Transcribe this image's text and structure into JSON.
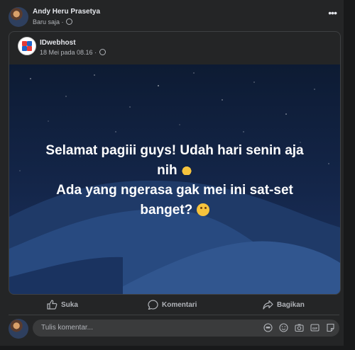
{
  "post": {
    "author_name": "Andy Heru Prasetya",
    "timestamp": "Baru saja",
    "privacy_icon": "globe-icon",
    "more_label": "•••"
  },
  "shared_post": {
    "page_name": "IDwebhost",
    "timestamp": "18 Mei pada 08.16",
    "privacy_icon": "globe-icon",
    "text_line1": "Selamat pagiii guys! Udah hari senin aja",
    "text_line2": "nih",
    "text_line3": "Ada yang ngerasa gak mei ini sat-set",
    "text_line4": "banget?"
  },
  "actions": {
    "like_label": "Suka",
    "comment_label": "Komentari",
    "share_label": "Bagikan"
  },
  "comment": {
    "placeholder": "Tulis komentar...",
    "icons": [
      "avatar-sticker-icon",
      "emoji-icon",
      "camera-icon",
      "gif-icon",
      "sticker-icon"
    ]
  },
  "colors": {
    "background": "#242526",
    "text_primary": "#e4e6eb",
    "text_secondary": "#b0b3b8",
    "comment_box": "#3a3b3c"
  }
}
